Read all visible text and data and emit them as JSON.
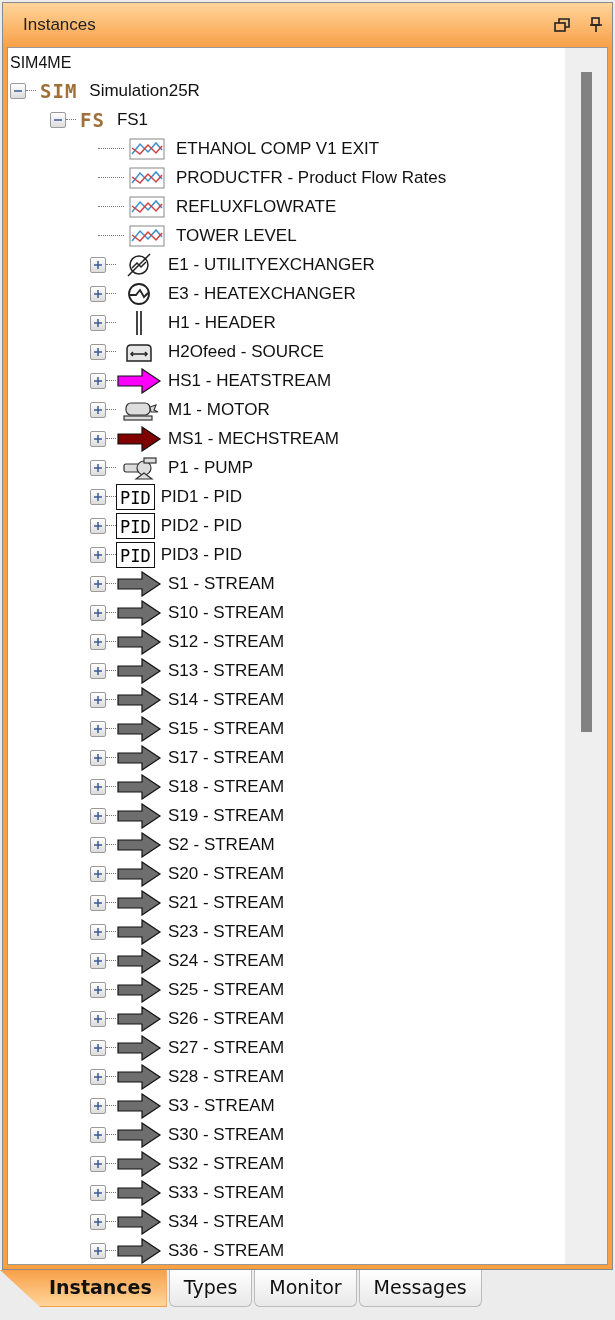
{
  "panel": {
    "title": "Instances"
  },
  "tree": {
    "root": "SIM4ME",
    "children": [
      {
        "badge": "SIM",
        "label": "Simulation25R",
        "expanded": true,
        "children": [
          {
            "badge": "FS",
            "label": "FS1",
            "expanded": true,
            "children": [
              {
                "kind": "trend",
                "label": "ETHANOL COMP V1 EXIT"
              },
              {
                "kind": "trend",
                "label": "PRODUCTFR - Product Flow Rates"
              },
              {
                "kind": "trend",
                "label": "REFLUXFLOWRATE"
              },
              {
                "kind": "trend",
                "label": "TOWER LEVEL"
              },
              {
                "kind": "utility-exchanger",
                "label": "E1 - UTILITYEXCHANGER",
                "expanded": false
              },
              {
                "kind": "heat-exchanger",
                "label": "E3 - HEATEXCHANGER",
                "expanded": false
              },
              {
                "kind": "header",
                "label": "H1 - HEADER",
                "expanded": false
              },
              {
                "kind": "source",
                "label": "H2Ofeed - SOURCE",
                "expanded": false
              },
              {
                "kind": "arrow",
                "color": "#ff00ff",
                "label": "HS1 - HEATSTREAM",
                "expanded": false
              },
              {
                "kind": "motor",
                "label": "M1 - MOTOR",
                "expanded": false
              },
              {
                "kind": "arrow",
                "color": "#800000",
                "label": "MS1 - MECHSTREAM",
                "expanded": false
              },
              {
                "kind": "pump",
                "label": "P1 - PUMP",
                "expanded": false
              },
              {
                "kind": "pid",
                "badge": "PID",
                "label": "PID1 - PID",
                "expanded": false
              },
              {
                "kind": "pid",
                "badge": "PID",
                "label": "PID2 - PID",
                "expanded": false
              },
              {
                "kind": "pid",
                "badge": "PID",
                "label": "PID3 - PID",
                "expanded": false
              },
              {
                "kind": "arrow",
                "color": "#6e6e6e",
                "label": "S1 - STREAM",
                "expanded": false
              },
              {
                "kind": "arrow",
                "color": "#6e6e6e",
                "label": "S10 - STREAM",
                "expanded": false
              },
              {
                "kind": "arrow",
                "color": "#6e6e6e",
                "label": "S12 - STREAM",
                "expanded": false
              },
              {
                "kind": "arrow",
                "color": "#6e6e6e",
                "label": "S13 - STREAM",
                "expanded": false
              },
              {
                "kind": "arrow",
                "color": "#6e6e6e",
                "label": "S14 - STREAM",
                "expanded": false
              },
              {
                "kind": "arrow",
                "color": "#6e6e6e",
                "label": "S15 - STREAM",
                "expanded": false
              },
              {
                "kind": "arrow",
                "color": "#6e6e6e",
                "label": "S17 - STREAM",
                "expanded": false
              },
              {
                "kind": "arrow",
                "color": "#6e6e6e",
                "label": "S18 - STREAM",
                "expanded": false
              },
              {
                "kind": "arrow",
                "color": "#6e6e6e",
                "label": "S19 - STREAM",
                "expanded": false
              },
              {
                "kind": "arrow",
                "color": "#6e6e6e",
                "label": "S2 - STREAM",
                "expanded": false
              },
              {
                "kind": "arrow",
                "color": "#6e6e6e",
                "label": "S20 - STREAM",
                "expanded": false
              },
              {
                "kind": "arrow",
                "color": "#6e6e6e",
                "label": "S21 - STREAM",
                "expanded": false
              },
              {
                "kind": "arrow",
                "color": "#6e6e6e",
                "label": "S23 - STREAM",
                "expanded": false
              },
              {
                "kind": "arrow",
                "color": "#6e6e6e",
                "label": "S24 - STREAM",
                "expanded": false
              },
              {
                "kind": "arrow",
                "color": "#6e6e6e",
                "label": "S25 - STREAM",
                "expanded": false
              },
              {
                "kind": "arrow",
                "color": "#6e6e6e",
                "label": "S26 - STREAM",
                "expanded": false
              },
              {
                "kind": "arrow",
                "color": "#6e6e6e",
                "label": "S27 - STREAM",
                "expanded": false
              },
              {
                "kind": "arrow",
                "color": "#6e6e6e",
                "label": "S28 - STREAM",
                "expanded": false
              },
              {
                "kind": "arrow",
                "color": "#6e6e6e",
                "label": "S3 - STREAM",
                "expanded": false
              },
              {
                "kind": "arrow",
                "color": "#6e6e6e",
                "label": "S30 - STREAM",
                "expanded": false
              },
              {
                "kind": "arrow",
                "color": "#6e6e6e",
                "label": "S32 - STREAM",
                "expanded": false
              },
              {
                "kind": "arrow",
                "color": "#6e6e6e",
                "label": "S33 - STREAM",
                "expanded": false
              },
              {
                "kind": "arrow",
                "color": "#6e6e6e",
                "label": "S34 - STREAM",
                "expanded": false
              },
              {
                "kind": "arrow",
                "color": "#6e6e6e",
                "label": "S36 - STREAM",
                "expanded": false
              }
            ]
          }
        ]
      }
    ]
  },
  "tabs": [
    {
      "label": "Instances",
      "selected": true
    },
    {
      "label": "Types",
      "selected": false
    },
    {
      "label": "Monitor",
      "selected": false
    },
    {
      "label": "Messages",
      "selected": false
    }
  ]
}
